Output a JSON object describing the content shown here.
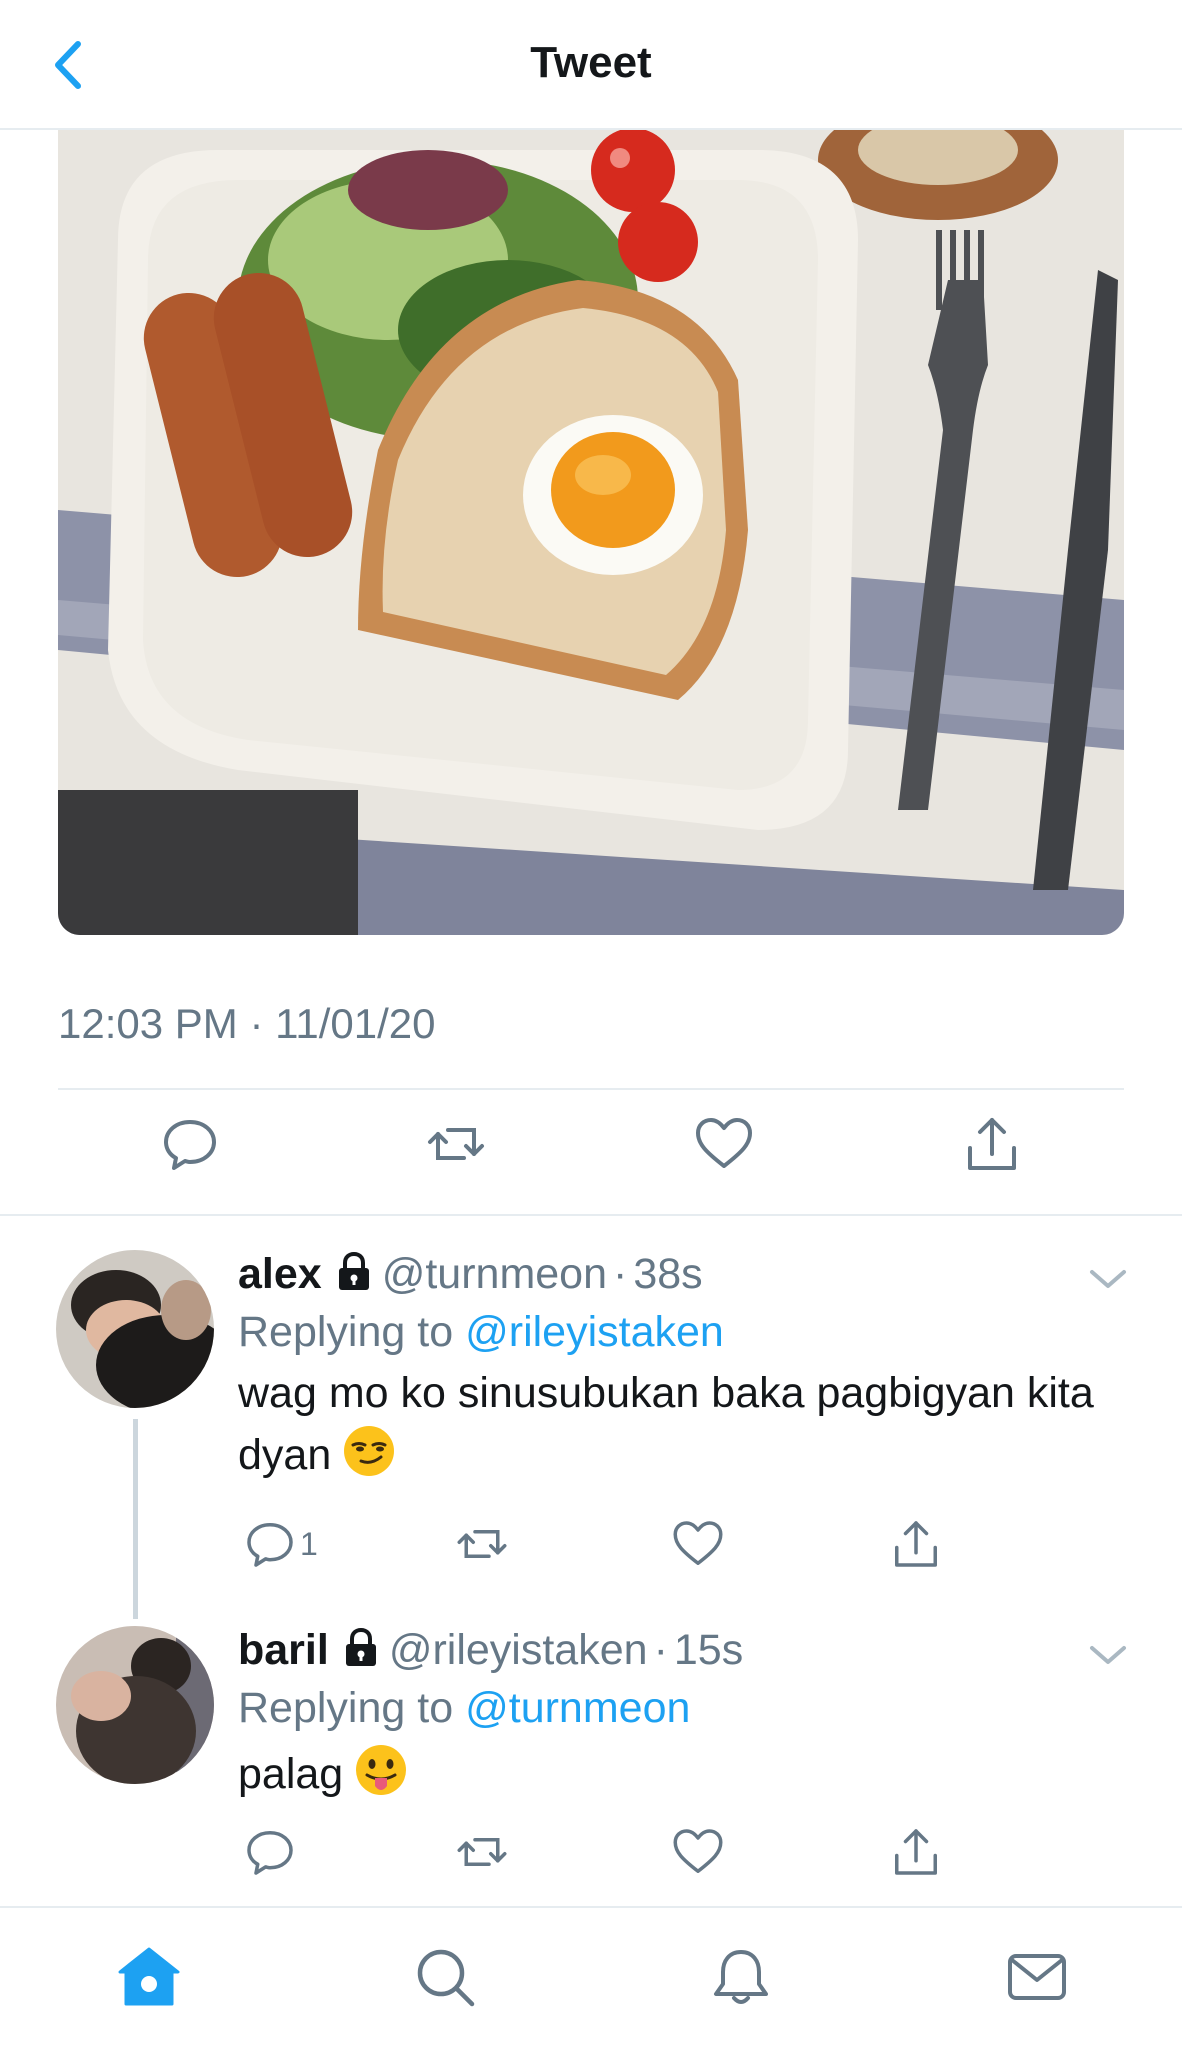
{
  "header": {
    "title": "Tweet",
    "back_icon": "chevron-left-icon"
  },
  "tweet": {
    "image_description": "food-photo",
    "timestamp": "12:03 PM · 11/01/20",
    "actions": [
      "reply-icon",
      "retweet-icon",
      "like-icon",
      "share-icon"
    ]
  },
  "replies": [
    {
      "name": "alex",
      "handle": "@turnmeon",
      "time": "38s",
      "replying_label": "Replying to",
      "replying_to": "@rileyistaken",
      "text": "wag mo ko sinusubukan baka pagbigyan kita dyan",
      "emoji": "smirking-face",
      "reply_count": "1"
    },
    {
      "name": "baril",
      "handle": "@rileyistaken",
      "time": "15s",
      "replying_label": "Replying to",
      "replying_to": "@turnmeon",
      "text": "palag",
      "emoji": "face-with-tongue",
      "reply_count": ""
    }
  ],
  "tabbar": {
    "items": [
      "home-icon",
      "search-icon",
      "notifications-icon",
      "messages-icon"
    ],
    "active": "home-icon"
  },
  "colors": {
    "accent": "#1da1f2",
    "secondary_text": "#657786",
    "divider": "#e6ecf0",
    "icon_gray": "#657786"
  }
}
